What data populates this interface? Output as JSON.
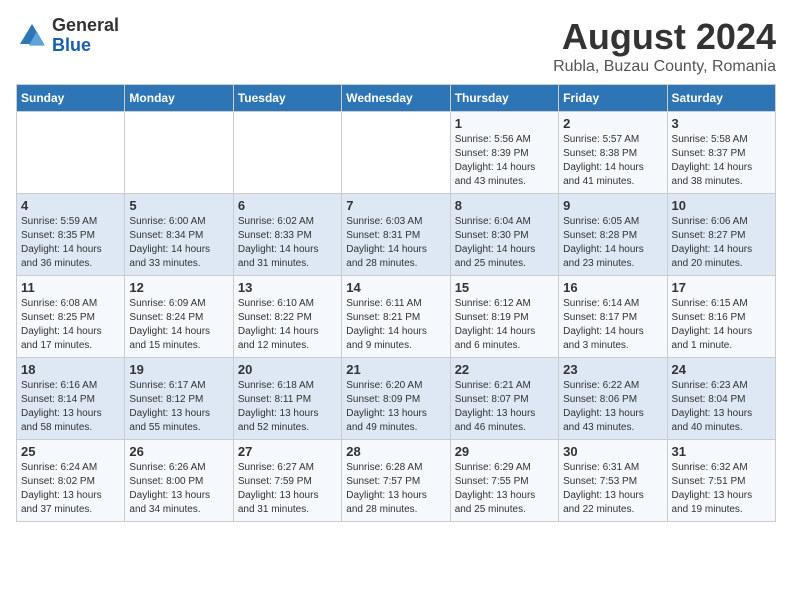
{
  "header": {
    "logo_general": "General",
    "logo_blue": "Blue",
    "main_title": "August 2024",
    "sub_title": "Rubla, Buzau County, Romania"
  },
  "weekdays": [
    "Sunday",
    "Monday",
    "Tuesday",
    "Wednesday",
    "Thursday",
    "Friday",
    "Saturday"
  ],
  "weeks": [
    [
      {
        "day": "",
        "info": ""
      },
      {
        "day": "",
        "info": ""
      },
      {
        "day": "",
        "info": ""
      },
      {
        "day": "",
        "info": ""
      },
      {
        "day": "1",
        "info": "Sunrise: 5:56 AM\nSunset: 8:39 PM\nDaylight: 14 hours\nand 43 minutes."
      },
      {
        "day": "2",
        "info": "Sunrise: 5:57 AM\nSunset: 8:38 PM\nDaylight: 14 hours\nand 41 minutes."
      },
      {
        "day": "3",
        "info": "Sunrise: 5:58 AM\nSunset: 8:37 PM\nDaylight: 14 hours\nand 38 minutes."
      }
    ],
    [
      {
        "day": "4",
        "info": "Sunrise: 5:59 AM\nSunset: 8:35 PM\nDaylight: 14 hours\nand 36 minutes."
      },
      {
        "day": "5",
        "info": "Sunrise: 6:00 AM\nSunset: 8:34 PM\nDaylight: 14 hours\nand 33 minutes."
      },
      {
        "day": "6",
        "info": "Sunrise: 6:02 AM\nSunset: 8:33 PM\nDaylight: 14 hours\nand 31 minutes."
      },
      {
        "day": "7",
        "info": "Sunrise: 6:03 AM\nSunset: 8:31 PM\nDaylight: 14 hours\nand 28 minutes."
      },
      {
        "day": "8",
        "info": "Sunrise: 6:04 AM\nSunset: 8:30 PM\nDaylight: 14 hours\nand 25 minutes."
      },
      {
        "day": "9",
        "info": "Sunrise: 6:05 AM\nSunset: 8:28 PM\nDaylight: 14 hours\nand 23 minutes."
      },
      {
        "day": "10",
        "info": "Sunrise: 6:06 AM\nSunset: 8:27 PM\nDaylight: 14 hours\nand 20 minutes."
      }
    ],
    [
      {
        "day": "11",
        "info": "Sunrise: 6:08 AM\nSunset: 8:25 PM\nDaylight: 14 hours\nand 17 minutes."
      },
      {
        "day": "12",
        "info": "Sunrise: 6:09 AM\nSunset: 8:24 PM\nDaylight: 14 hours\nand 15 minutes."
      },
      {
        "day": "13",
        "info": "Sunrise: 6:10 AM\nSunset: 8:22 PM\nDaylight: 14 hours\nand 12 minutes."
      },
      {
        "day": "14",
        "info": "Sunrise: 6:11 AM\nSunset: 8:21 PM\nDaylight: 14 hours\nand 9 minutes."
      },
      {
        "day": "15",
        "info": "Sunrise: 6:12 AM\nSunset: 8:19 PM\nDaylight: 14 hours\nand 6 minutes."
      },
      {
        "day": "16",
        "info": "Sunrise: 6:14 AM\nSunset: 8:17 PM\nDaylight: 14 hours\nand 3 minutes."
      },
      {
        "day": "17",
        "info": "Sunrise: 6:15 AM\nSunset: 8:16 PM\nDaylight: 14 hours\nand 1 minute."
      }
    ],
    [
      {
        "day": "18",
        "info": "Sunrise: 6:16 AM\nSunset: 8:14 PM\nDaylight: 13 hours\nand 58 minutes."
      },
      {
        "day": "19",
        "info": "Sunrise: 6:17 AM\nSunset: 8:12 PM\nDaylight: 13 hours\nand 55 minutes."
      },
      {
        "day": "20",
        "info": "Sunrise: 6:18 AM\nSunset: 8:11 PM\nDaylight: 13 hours\nand 52 minutes."
      },
      {
        "day": "21",
        "info": "Sunrise: 6:20 AM\nSunset: 8:09 PM\nDaylight: 13 hours\nand 49 minutes."
      },
      {
        "day": "22",
        "info": "Sunrise: 6:21 AM\nSunset: 8:07 PM\nDaylight: 13 hours\nand 46 minutes."
      },
      {
        "day": "23",
        "info": "Sunrise: 6:22 AM\nSunset: 8:06 PM\nDaylight: 13 hours\nand 43 minutes."
      },
      {
        "day": "24",
        "info": "Sunrise: 6:23 AM\nSunset: 8:04 PM\nDaylight: 13 hours\nand 40 minutes."
      }
    ],
    [
      {
        "day": "25",
        "info": "Sunrise: 6:24 AM\nSunset: 8:02 PM\nDaylight: 13 hours\nand 37 minutes."
      },
      {
        "day": "26",
        "info": "Sunrise: 6:26 AM\nSunset: 8:00 PM\nDaylight: 13 hours\nand 34 minutes."
      },
      {
        "day": "27",
        "info": "Sunrise: 6:27 AM\nSunset: 7:59 PM\nDaylight: 13 hours\nand 31 minutes."
      },
      {
        "day": "28",
        "info": "Sunrise: 6:28 AM\nSunset: 7:57 PM\nDaylight: 13 hours\nand 28 minutes."
      },
      {
        "day": "29",
        "info": "Sunrise: 6:29 AM\nSunset: 7:55 PM\nDaylight: 13 hours\nand 25 minutes."
      },
      {
        "day": "30",
        "info": "Sunrise: 6:31 AM\nSunset: 7:53 PM\nDaylight: 13 hours\nand 22 minutes."
      },
      {
        "day": "31",
        "info": "Sunrise: 6:32 AM\nSunset: 7:51 PM\nDaylight: 13 hours\nand 19 minutes."
      }
    ]
  ]
}
